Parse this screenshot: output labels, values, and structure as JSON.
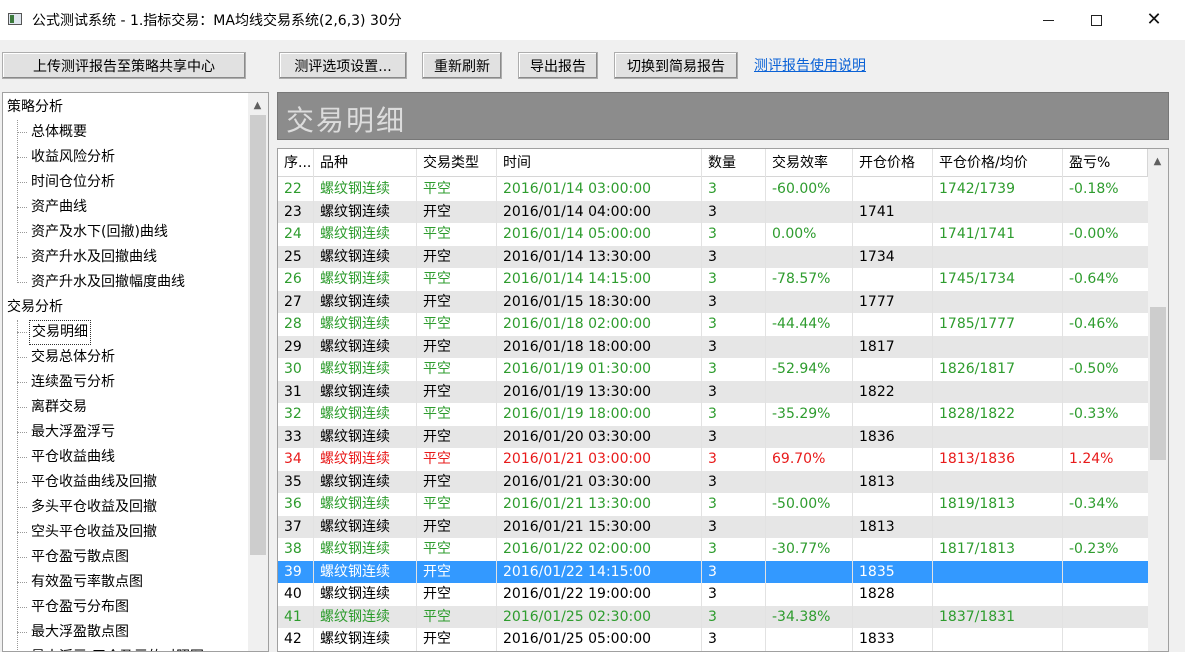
{
  "window": {
    "title": "公式测试系统 - 1.指标交易：MA均线交易系统(2,6,3) 30分",
    "minimize": "—",
    "maximize": "☐",
    "close": "✕"
  },
  "toolbar": {
    "upload": "上传测评报告至策略共享中心",
    "settings": "测评选项设置...",
    "refresh": "重新刷新",
    "export": "导出报告",
    "switch": "切换到简易报告",
    "help_link": "测评报告使用说明"
  },
  "tree": {
    "groups": [
      {
        "label": "策略分析",
        "items": [
          "总体概要",
          "收益风险分析",
          "时间仓位分析",
          "资产曲线",
          "资产及水下(回撤)曲线",
          "资产升水及回撤曲线",
          "资产升水及回撤幅度曲线"
        ]
      },
      {
        "label": "交易分析",
        "items": [
          "交易明细",
          "交易总体分析",
          "连续盈亏分析",
          "离群交易",
          "最大浮盈浮亏",
          "平仓收益曲线",
          "平仓收益曲线及回撤",
          "多头平仓收益及回撤",
          "空头平仓收益及回撤",
          "平仓盈亏散点图",
          "有效盈亏率散点图",
          "平仓盈亏分布图",
          "最大浮盈散点图",
          "最大浮亏-平仓盈亏的对照图"
        ]
      }
    ],
    "selected": "交易明细"
  },
  "section_title": "交易明细",
  "table": {
    "columns": [
      "序...",
      "品种",
      "交易类型",
      "时间",
      "数量",
      "交易效率",
      "开仓价格",
      "平仓价格/均价",
      "盈亏%"
    ],
    "rows": [
      {
        "no": "22",
        "symbol": "螺纹钢连续",
        "type": "平空",
        "time": "2016/01/14 03:00:00",
        "qty": "3",
        "eff": "-60.00%",
        "open": "",
        "close": "1742/1739",
        "pnl": "-0.18%",
        "color": "green"
      },
      {
        "no": "23",
        "symbol": "螺纹钢连续",
        "type": "开空",
        "time": "2016/01/14 04:00:00",
        "qty": "3",
        "eff": "",
        "open": "1741",
        "close": "",
        "pnl": "",
        "color": "black"
      },
      {
        "no": "24",
        "symbol": "螺纹钢连续",
        "type": "平空",
        "time": "2016/01/14 05:00:00",
        "qty": "3",
        "eff": "0.00%",
        "open": "",
        "close": "1741/1741",
        "pnl": "-0.00%",
        "color": "green"
      },
      {
        "no": "25",
        "symbol": "螺纹钢连续",
        "type": "开空",
        "time": "2016/01/14 13:30:00",
        "qty": "3",
        "eff": "",
        "open": "1734",
        "close": "",
        "pnl": "",
        "color": "black"
      },
      {
        "no": "26",
        "symbol": "螺纹钢连续",
        "type": "平空",
        "time": "2016/01/14 14:15:00",
        "qty": "3",
        "eff": "-78.57%",
        "open": "",
        "close": "1745/1734",
        "pnl": "-0.64%",
        "color": "green"
      },
      {
        "no": "27",
        "symbol": "螺纹钢连续",
        "type": "开空",
        "time": "2016/01/15 18:30:00",
        "qty": "3",
        "eff": "",
        "open": "1777",
        "close": "",
        "pnl": "",
        "color": "black"
      },
      {
        "no": "28",
        "symbol": "螺纹钢连续",
        "type": "平空",
        "time": "2016/01/18 02:00:00",
        "qty": "3",
        "eff": "-44.44%",
        "open": "",
        "close": "1785/1777",
        "pnl": "-0.46%",
        "color": "green"
      },
      {
        "no": "29",
        "symbol": "螺纹钢连续",
        "type": "开空",
        "time": "2016/01/18 18:00:00",
        "qty": "3",
        "eff": "",
        "open": "1817",
        "close": "",
        "pnl": "",
        "color": "black"
      },
      {
        "no": "30",
        "symbol": "螺纹钢连续",
        "type": "平空",
        "time": "2016/01/19 01:30:00",
        "qty": "3",
        "eff": "-52.94%",
        "open": "",
        "close": "1826/1817",
        "pnl": "-0.50%",
        "color": "green"
      },
      {
        "no": "31",
        "symbol": "螺纹钢连续",
        "type": "开空",
        "time": "2016/01/19 13:30:00",
        "qty": "3",
        "eff": "",
        "open": "1822",
        "close": "",
        "pnl": "",
        "color": "black"
      },
      {
        "no": "32",
        "symbol": "螺纹钢连续",
        "type": "平空",
        "time": "2016/01/19 18:00:00",
        "qty": "3",
        "eff": "-35.29%",
        "open": "",
        "close": "1828/1822",
        "pnl": "-0.33%",
        "color": "green"
      },
      {
        "no": "33",
        "symbol": "螺纹钢连续",
        "type": "开空",
        "time": "2016/01/20 03:30:00",
        "qty": "3",
        "eff": "",
        "open": "1836",
        "close": "",
        "pnl": "",
        "color": "black"
      },
      {
        "no": "34",
        "symbol": "螺纹钢连续",
        "type": "平空",
        "time": "2016/01/21 03:00:00",
        "qty": "3",
        "eff": "69.70%",
        "open": "",
        "close": "1813/1836",
        "pnl": "1.24%",
        "color": "red"
      },
      {
        "no": "35",
        "symbol": "螺纹钢连续",
        "type": "开空",
        "time": "2016/01/21 03:30:00",
        "qty": "3",
        "eff": "",
        "open": "1813",
        "close": "",
        "pnl": "",
        "color": "black"
      },
      {
        "no": "36",
        "symbol": "螺纹钢连续",
        "type": "平空",
        "time": "2016/01/21 13:30:00",
        "qty": "3",
        "eff": "-50.00%",
        "open": "",
        "close": "1819/1813",
        "pnl": "-0.34%",
        "color": "green"
      },
      {
        "no": "37",
        "symbol": "螺纹钢连续",
        "type": "开空",
        "time": "2016/01/21 15:30:00",
        "qty": "3",
        "eff": "",
        "open": "1813",
        "close": "",
        "pnl": "",
        "color": "black"
      },
      {
        "no": "38",
        "symbol": "螺纹钢连续",
        "type": "平空",
        "time": "2016/01/22 02:00:00",
        "qty": "3",
        "eff": "-30.77%",
        "open": "",
        "close": "1817/1813",
        "pnl": "-0.23%",
        "color": "green"
      },
      {
        "no": "39",
        "symbol": "螺纹钢连续",
        "type": "开空",
        "time": "2016/01/22 14:15:00",
        "qty": "3",
        "eff": "",
        "open": "1835",
        "close": "",
        "pnl": "",
        "color": "black",
        "selected": true
      },
      {
        "no": "40",
        "symbol": "螺纹钢连续",
        "type": "开空",
        "time": "2016/01/22 19:00:00",
        "qty": "3",
        "eff": "",
        "open": "1828",
        "close": "",
        "pnl": "",
        "color": "black"
      },
      {
        "no": "41",
        "symbol": "螺纹钢连续",
        "type": "平空",
        "time": "2016/01/25 02:30:00",
        "qty": "3",
        "eff": "-34.38%",
        "open": "",
        "close": "1837/1831",
        "pnl": "",
        "color": "green"
      },
      {
        "no": "42",
        "symbol": "螺纹钢连续",
        "type": "开空",
        "time": "2016/01/25 05:00:00",
        "qty": "3",
        "eff": "",
        "open": "1833",
        "close": "",
        "pnl": "",
        "color": "black"
      }
    ]
  },
  "colors": {
    "accent": "#3399ff",
    "profit": "#e81b1b",
    "loss": "#2e9c2e",
    "link": "#0b62d6"
  }
}
